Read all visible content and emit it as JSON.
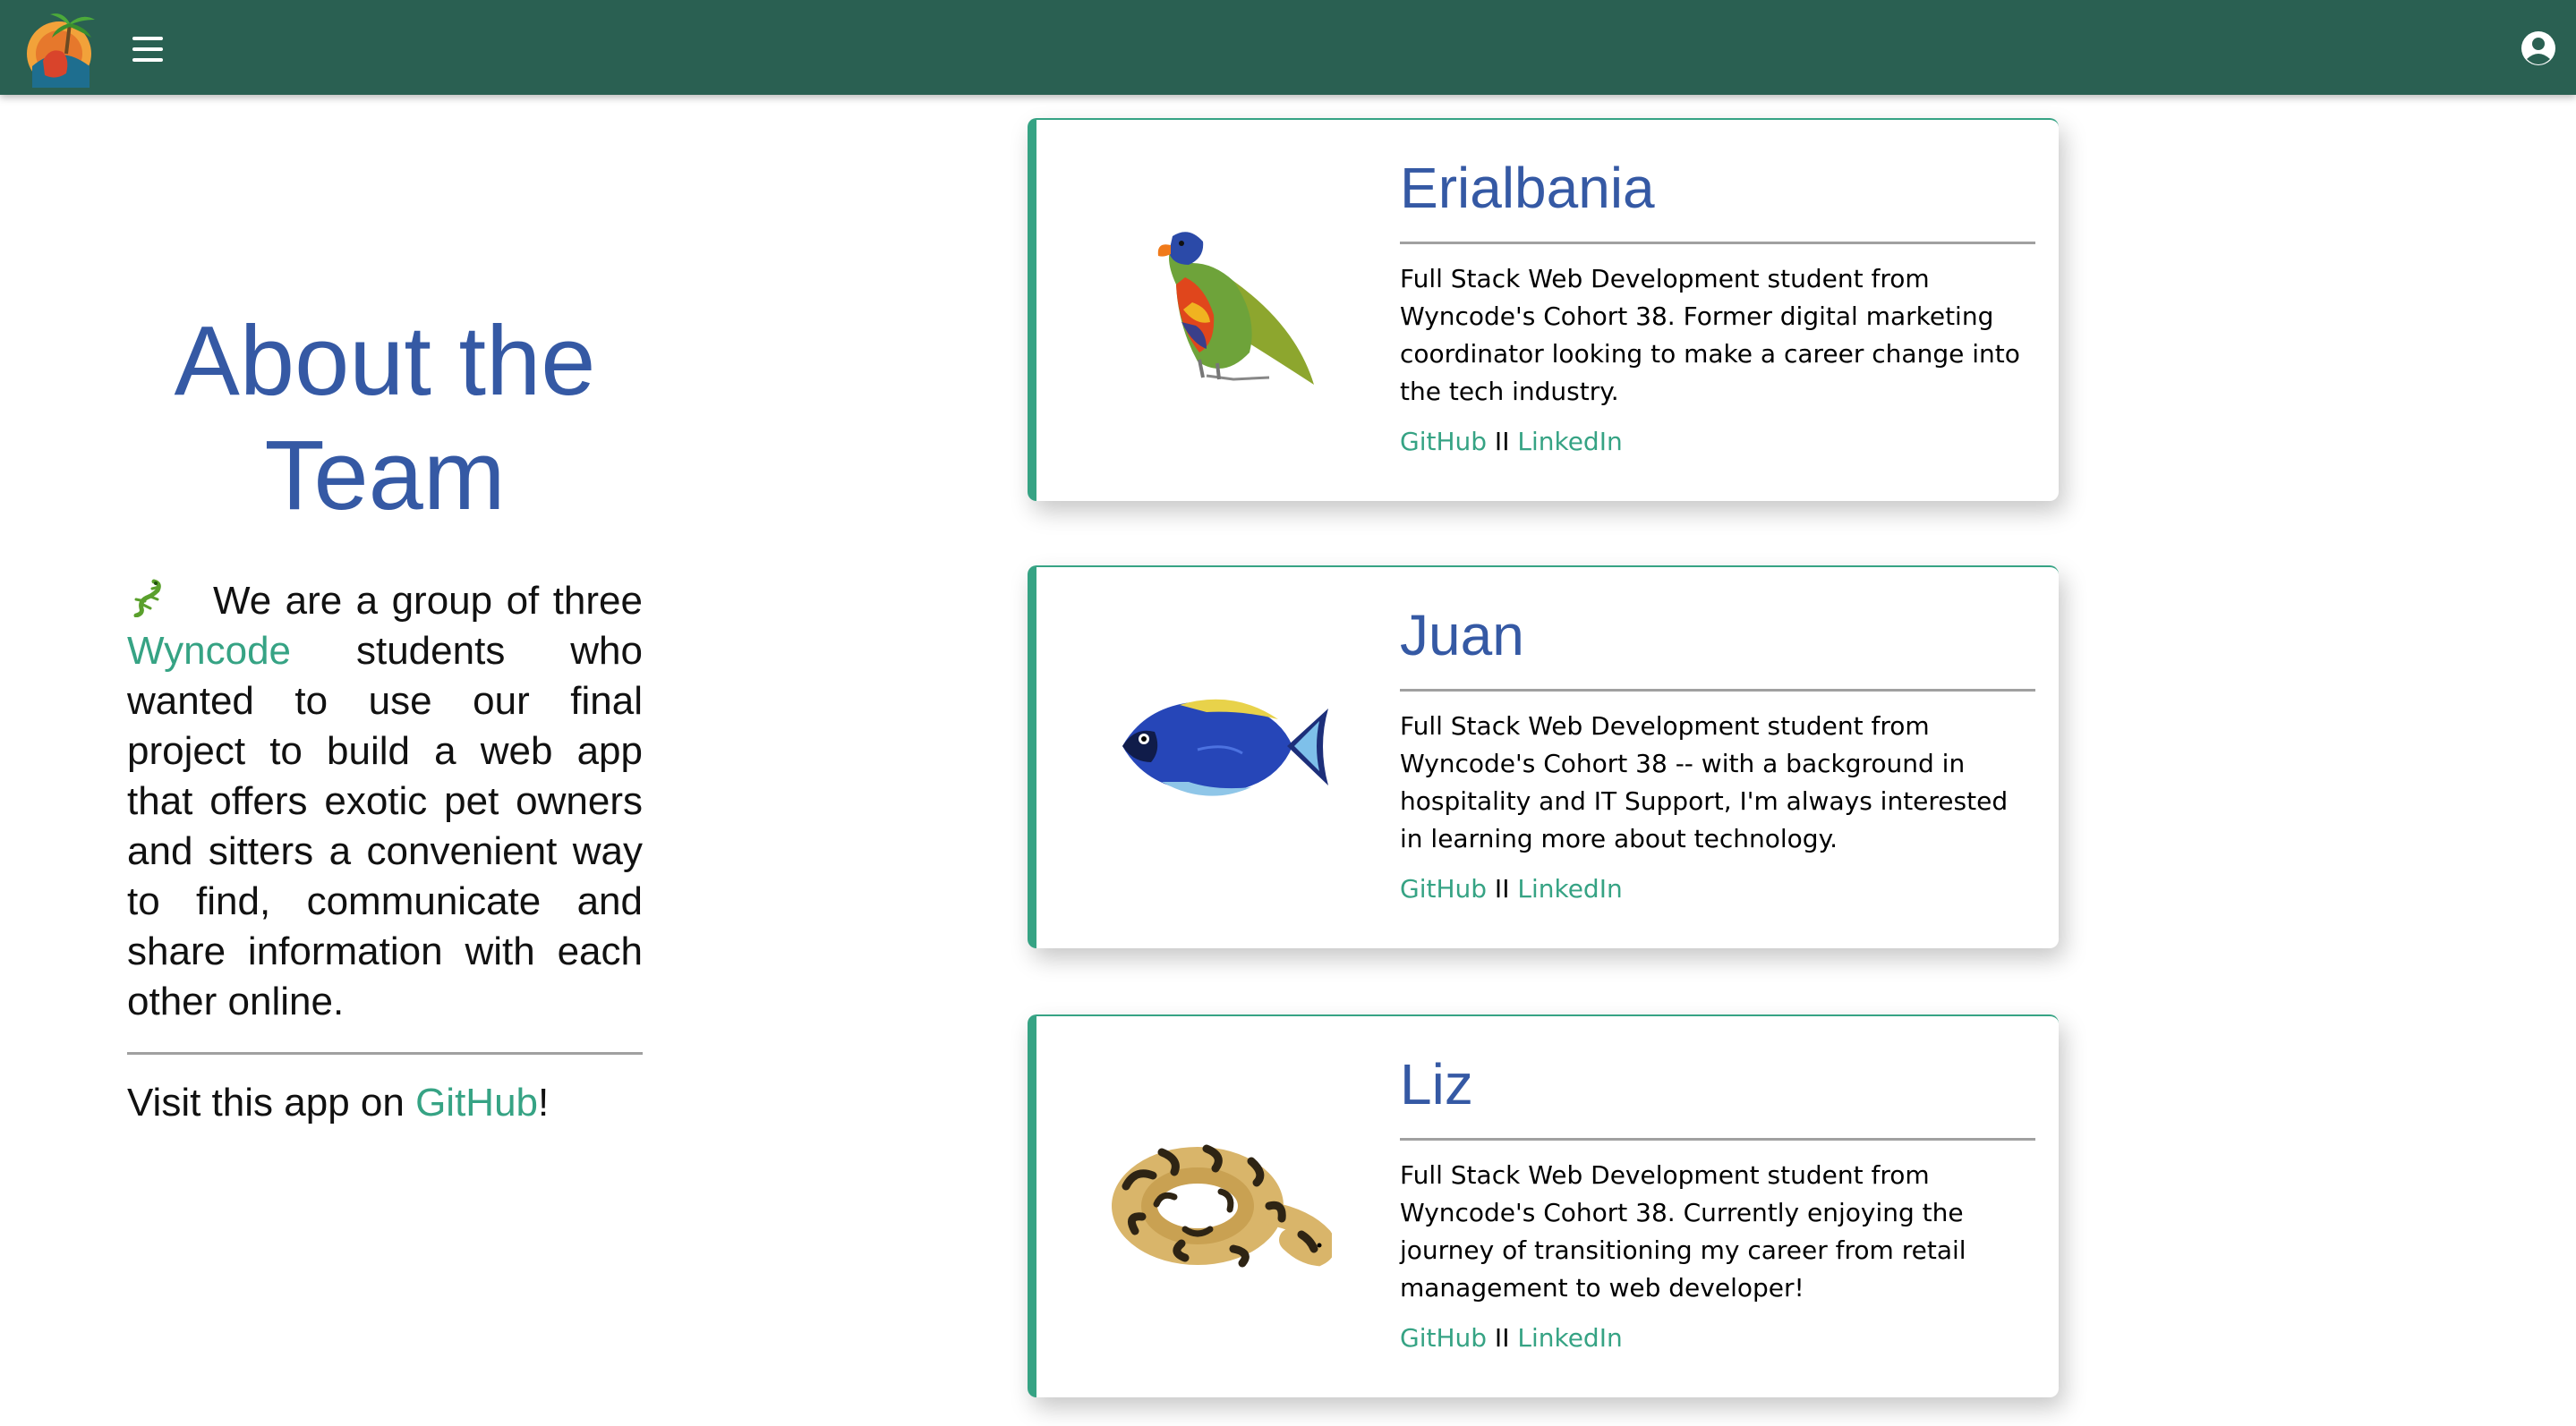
{
  "colors": {
    "app_bar": "#2a6052",
    "accent_teal": "#36a384",
    "heading_blue": "#3559a4",
    "divider": "#a0a0a0"
  },
  "header": {
    "logo_icon": "tropical-island-logo-icon",
    "menu_icon": "hamburger-menu-icon",
    "account_icon": "account-circle-icon"
  },
  "intro": {
    "title": "About the Team",
    "icon": "lizard-icon",
    "desc_before": "We are a group of three ",
    "desc_link": "Wyncode",
    "desc_after": " students who wanted to use our final project to build a web app that offers exotic pet owners and sitters a convenient way to find, communicate and share information with each other online.",
    "visit_before": "Visit this app on ",
    "visit_link": "GitHub",
    "visit_after": "!"
  },
  "members": [
    {
      "name": "Erialbania",
      "image": "parrot-image",
      "bio": "Full Stack Web Development student from Wyncode's Cohort 38. Former digital marketing coordinator looking to make a career change into the tech industry.",
      "github": "GitHub",
      "separator": " II ",
      "linkedin": "LinkedIn"
    },
    {
      "name": "Juan",
      "image": "blue-tang-fish-image",
      "bio": "Full Stack Web Development student from Wyncode's Cohort 38 -- with a background in hospitality and IT Support, I'm always interested in learning more about technology.",
      "github": "GitHub",
      "separator": " II ",
      "linkedin": "LinkedIn"
    },
    {
      "name": "Liz",
      "image": "ball-python-snake-image",
      "bio": "Full Stack Web Development student from Wyncode's Cohort 38. Currently enjoying the journey of transitioning my career from retail management to web developer!",
      "github": "GitHub",
      "separator": " II ",
      "linkedin": "LinkedIn"
    }
  ]
}
